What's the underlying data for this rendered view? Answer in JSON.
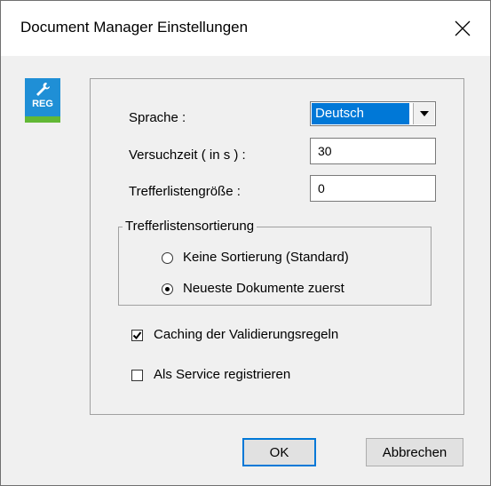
{
  "window": {
    "title": "Document Manager Einstellungen",
    "close_glyph": "✕",
    "logo_text": "REG"
  },
  "settings": {
    "language_label": "Sprache :",
    "language_value": "Deutsch",
    "timeout_label": "Versuchzeit ( in s ) :",
    "timeout_value": "30",
    "list_size_label": "Trefferlistengröße :",
    "list_size_value": "0"
  },
  "sorting": {
    "legend": "Trefferlistensortierung",
    "options": [
      {
        "label": "Keine Sortierung (Standard)",
        "selected": false
      },
      {
        "label": "Neueste Dokumente zuerst",
        "selected": true
      }
    ]
  },
  "options": {
    "caching_label": "Caching der Validierungsregeln",
    "caching_checked": true,
    "service_label": "Als Service registrieren",
    "service_checked": false
  },
  "buttons": {
    "ok": "OK",
    "cancel": "Abbrechen"
  },
  "colors": {
    "accent": "#0078d7",
    "logo_blue": "#1f8fd6",
    "logo_green": "#62b835",
    "dialog_bg": "#f0f0f0"
  }
}
